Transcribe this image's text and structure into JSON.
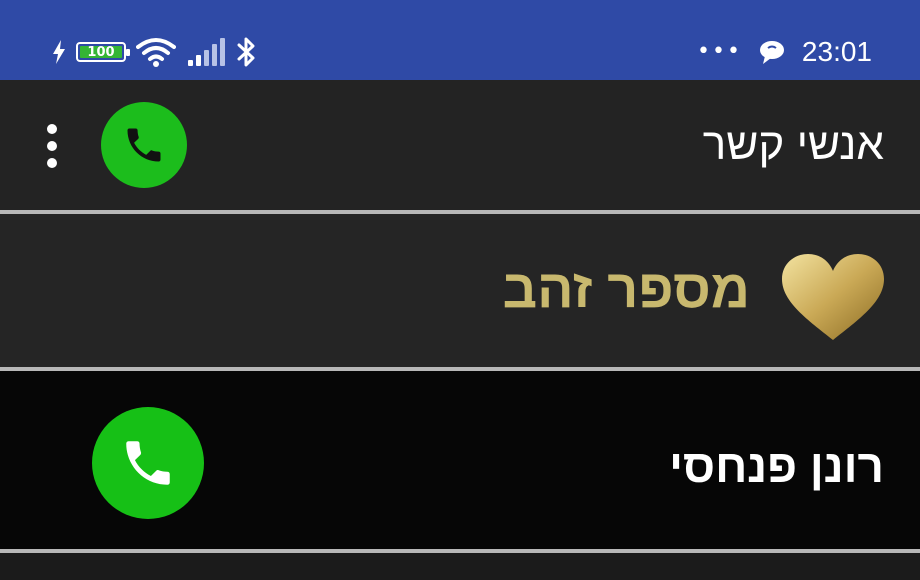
{
  "status_bar": {
    "battery_level": "100",
    "time": "23:01",
    "overflow_dots": "•••",
    "icons": [
      "charging-icon",
      "battery-icon",
      "wifi-icon",
      "signal-icon",
      "bluetooth-icon",
      "more-notifications-icon",
      "chat-bubble-icon"
    ],
    "background": "#2f4aa6"
  },
  "header": {
    "title": "אנשי קשר",
    "background": "#232323"
  },
  "gold_section": {
    "title": "מספר זהב",
    "color": "#c8b86e"
  },
  "contacts": [
    {
      "name": "רונן פנחסי"
    }
  ],
  "colors": {
    "call_green": "#1cbd1c",
    "divider": "#b8b8b8"
  }
}
